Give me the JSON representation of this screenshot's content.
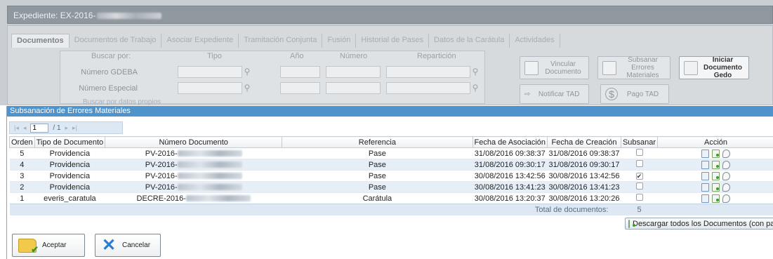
{
  "expediente": {
    "title": "Expediente: EX-2016-"
  },
  "tabs": [
    "Documentos",
    "Documentos de Trabajo",
    "Asociar Expediente",
    "Tramitación Conjunta",
    "Fusión",
    "Historial de Pases",
    "Datos de la Carátula",
    "Actividades"
  ],
  "search": {
    "buscar_por": "Buscar por:",
    "col_tipo": "Tipo",
    "col_anio": "Año",
    "col_numero": "Número",
    "col_reparticion": "Repartición",
    "row1": "Número GDEBA",
    "row2": "Número Especial",
    "link": "Buscar por datos propios"
  },
  "actions": {
    "vincular": "Vincular Documento",
    "subsanar": "Subsanar Errores Materiales",
    "iniciar": "Iniciar Documento Gedo",
    "notificar": "Notificar TAD",
    "pago": "Pago TAD"
  },
  "modal": {
    "title": "Subsanación de Errores Materiales",
    "pager": {
      "page": "1",
      "total": "/ 1"
    },
    "headers": [
      "Orden",
      "Tipo de Documento",
      "Número Documento",
      "Referencia",
      "Fecha de Asociación",
      "Fecha de Creación",
      "Subsanar",
      "Acción"
    ],
    "rows": [
      {
        "orden": "5",
        "tipo": "Providencia",
        "numero": "PV-2016-",
        "referencia": "Pase",
        "fecha_asoc": "31/08/2016 09:38:37",
        "fecha_creacion": "31/08/2016 09:38:37",
        "subsanar": false
      },
      {
        "orden": "4",
        "tipo": "Providencia",
        "numero": "PV-2016-",
        "referencia": "Pase",
        "fecha_asoc": "31/08/2016 09:30:17",
        "fecha_creacion": "31/08/2016 09:30:17",
        "subsanar": false
      },
      {
        "orden": "3",
        "tipo": "Providencia",
        "numero": "PV-2016-",
        "referencia": "Pase",
        "fecha_asoc": "30/08/2016 13:42:56",
        "fecha_creacion": "30/08/2016 13:42:56",
        "subsanar": true
      },
      {
        "orden": "2",
        "tipo": "Providencia",
        "numero": "PV-2016-",
        "referencia": "Pase",
        "fecha_asoc": "30/08/2016 13:41:23",
        "fecha_creacion": "30/08/2016 13:41:23",
        "subsanar": false
      },
      {
        "orden": "1",
        "tipo": "everis_caratula",
        "numero": "DECRE-2016-",
        "referencia": "Carátula",
        "fecha_asoc": "30/08/2016 13:20:37",
        "fecha_creacion": "30/08/2016 13:20:26",
        "subsanar": false
      }
    ],
    "total_label": "Total de documentos:",
    "total_value": "5",
    "download_all": "Descargar todos los Documentos (con pase)",
    "accept": "Aceptar",
    "cancel": "Cancelar"
  }
}
